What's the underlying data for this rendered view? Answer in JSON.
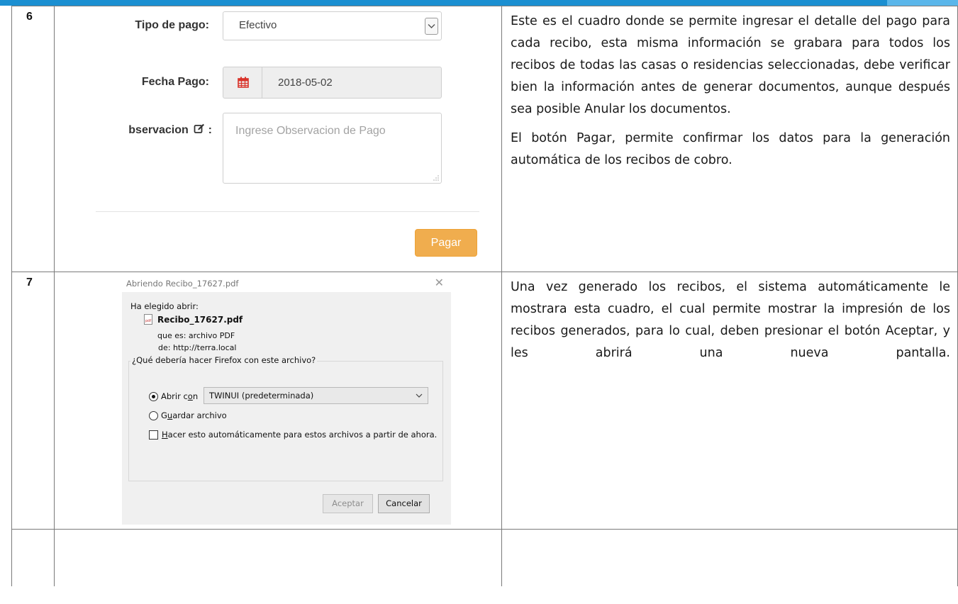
{
  "row6": {
    "number": "6",
    "form": {
      "tipo_label": "Tipo de pago:",
      "tipo_value": "Efectivo",
      "fecha_label": "Fecha Pago:",
      "fecha_value": "2018-05-02",
      "obs_label": "bservacion",
      "obs_label_suffix": ":",
      "obs_placeholder": "Ingrese Observacion de Pago",
      "pay_button": "Pagar",
      "pay_button_color": "#f0ad4e"
    },
    "description": [
      "Este es el cuadro donde se permite ingresar el detalle del pago para cada recibo, esta misma información se grabara para todos los recibos de todas las casas o residencias seleccionadas, debe verificar bien la información antes de generar documentos, aunque después sea posible Anular los documentos.",
      "El botón Pagar, permite confirmar los datos para la generación automática de los recibos de cobro."
    ]
  },
  "row7": {
    "number": "7",
    "dialog": {
      "title": "Abriendo Recibo_17627.pdf",
      "elegido": "Ha elegido abrir:",
      "file_icon_text": "pdf",
      "filename": "Recibo_17627.pdf",
      "que_es": "que es:  archivo PDF",
      "de": "de:  http://terra.local",
      "question": "¿Qué debería hacer Firefox con este archivo?",
      "open_with_pre": "Abrir c",
      "open_with_u": "o",
      "open_with_post": "n",
      "app": "TWINUI (predeterminada)",
      "save_pre": "G",
      "save_u": "u",
      "save_post": "ardar archivo",
      "auto_u": "H",
      "auto_post": "acer esto automáticamente para estos archivos a partir de ahora.",
      "ok": "Aceptar",
      "cancel": "Cancelar"
    },
    "description": [
      "Una vez generado los recibos, el sistema automáticamente le mostrara esta cuadro, el cual permite mostrar la impresión de los recibos generados, para lo cual, deben presionar el botón Aceptar, y les abrirá una nueva pantalla."
    ]
  },
  "colors": {
    "top_bar": "#1b8fd1",
    "pay_button": "#f0ad4e",
    "calendar_icon": "#d9332a"
  }
}
